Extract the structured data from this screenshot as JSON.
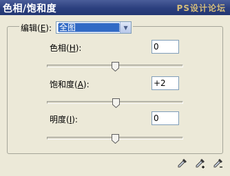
{
  "window": {
    "title": "色相/饱和度",
    "watermark": "PS设计论坛"
  },
  "edit": {
    "label_prefix": "编辑(",
    "label_key": "E",
    "label_suffix": "):",
    "selected": "全图"
  },
  "fields": [
    {
      "label_prefix": "色相(",
      "key": "H",
      "label_suffix": "):",
      "value": "0",
      "level": 0.5
    },
    {
      "label_prefix": "饱和度(",
      "key": "A",
      "label_suffix": "):",
      "value": "+2",
      "level": 0.51
    },
    {
      "label_prefix": "明度(",
      "key": "I",
      "label_suffix": "):",
      "value": "0",
      "level": 0.5
    }
  ],
  "tools": [
    "eyedropper-icon",
    "eyedropper-plus-icon",
    "eyedropper-minus-icon"
  ],
  "colors": {
    "titlebar": "#2b3f7e",
    "selection": "#316ac5",
    "dialog": "#ece9d8"
  }
}
